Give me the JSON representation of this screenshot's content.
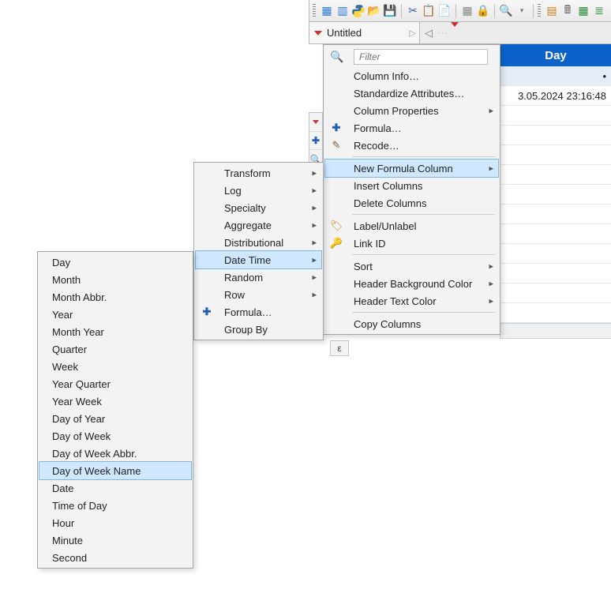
{
  "toolbar": {
    "icons": [
      "new-data-icon",
      "new-script-icon",
      "python-icon",
      "open-icon",
      "save-icon",
      "cut-icon",
      "copy-icon",
      "paste-icon",
      "grid-icon",
      "lock-icon",
      "search-icon",
      "data-table-icon",
      "calculator-icon",
      "tile-icon",
      "stack-icon"
    ]
  },
  "tab": {
    "title": "Untitled"
  },
  "column": {
    "header": "Day",
    "marker": "•",
    "cell_value": "3.05.2024 23:16:48"
  },
  "col_total_label": "ε",
  "menu_main": {
    "filter_placeholder": "Filter",
    "items": {
      "column_info": "Column Info…",
      "standardize": "Standardize Attributes…",
      "column_props": "Column Properties",
      "formula": "Formula…",
      "recode": "Recode…",
      "new_formula_col": "New Formula Column",
      "insert_cols": "Insert Columns",
      "delete_cols": "Delete Columns",
      "label_unlabel": "Label/Unlabel",
      "link_id": "Link ID",
      "sort": "Sort",
      "hdr_bg": "Header Background Color",
      "hdr_txt": "Header Text Color",
      "copy_cols": "Copy Columns"
    }
  },
  "menu_transform": {
    "items": {
      "transform": "Transform",
      "log": "Log",
      "specialty": "Specialty",
      "aggregate": "Aggregate",
      "distributional": "Distributional",
      "date_time": "Date Time",
      "random": "Random",
      "row": "Row",
      "formula": "Formula…",
      "group_by": "Group By"
    }
  },
  "menu_datetime": {
    "items": [
      "Day",
      "Month",
      "Month Abbr.",
      "Year",
      "Month Year",
      "Quarter",
      "Week",
      "Year Quarter",
      "Year Week",
      "Day of Year",
      "Day of Week",
      "Day of Week Abbr.",
      "Day of Week Name",
      "Date",
      "Time of Day",
      "Hour",
      "Minute",
      "Second"
    ],
    "highlight_index": 12
  }
}
